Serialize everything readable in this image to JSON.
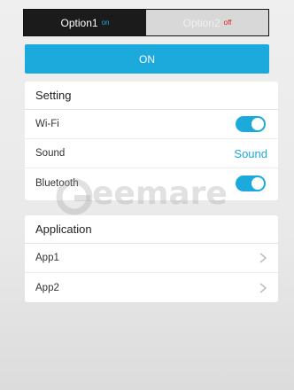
{
  "segmented": {
    "option1": {
      "label": "Option1",
      "state": "on"
    },
    "option2": {
      "label": "Option2",
      "state": "off"
    }
  },
  "on_bar": {
    "label": "ON"
  },
  "setting_card": {
    "title": "Setting",
    "rows": [
      {
        "label": "Wi-Fi",
        "control": "toggle",
        "toggle_on": true
      },
      {
        "label": "Sound",
        "control": "text",
        "value": "Sound"
      },
      {
        "label": "Bluetooth",
        "control": "toggle",
        "toggle_on": true
      }
    ]
  },
  "application_card": {
    "title": "Application",
    "rows": [
      {
        "label": "App1",
        "icon": "chevron-right-icon"
      },
      {
        "label": "App2",
        "icon": "chevron-right-icon"
      }
    ]
  },
  "watermark": {
    "text": "eemare"
  },
  "colors": {
    "accent": "#1ca9db",
    "off_red": "#d9241c",
    "dark_segment": "#1b1b1b",
    "background": "#eeeeee"
  }
}
